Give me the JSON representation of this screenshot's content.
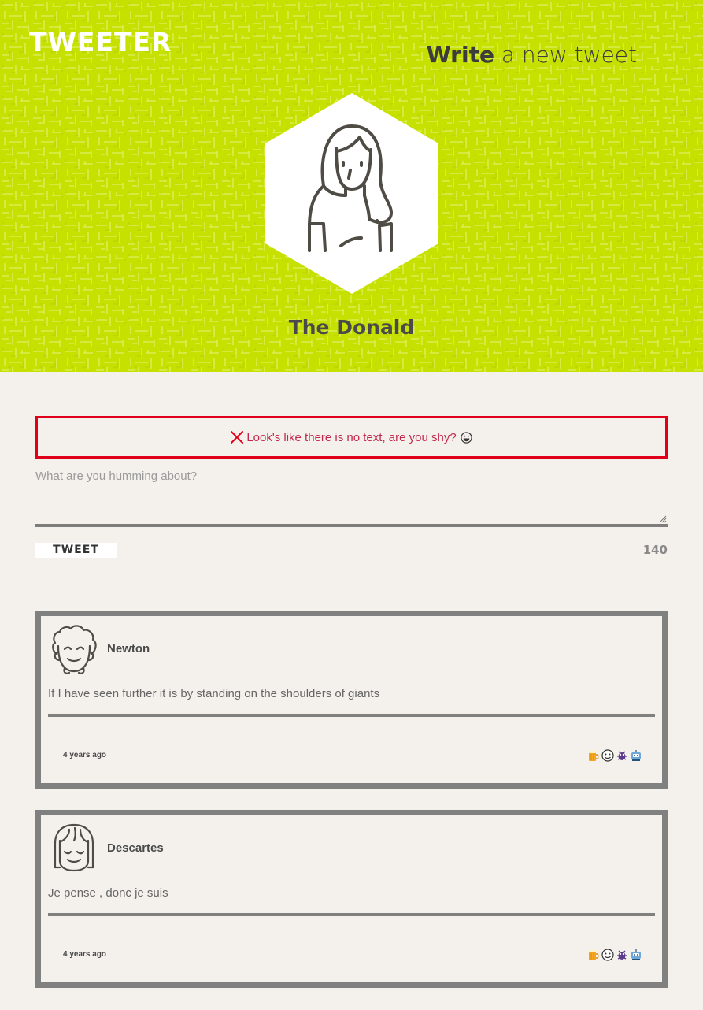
{
  "header": {
    "logo": "TWEETER",
    "title_bold": "Write",
    "title_rest": " a new tweet",
    "profile_name": "The Donald",
    "accent_color": "#c6e100"
  },
  "composer": {
    "error_message": "Look's like there is no text, are you shy?",
    "error_color": "#e0001b",
    "placeholder": "What are you humming about?",
    "value": "",
    "button_label": "TWEET",
    "char_count": "140"
  },
  "tweets": [
    {
      "author": "Newton",
      "text": "If I have seen further it is by standing on the shoulders of giants",
      "time": "4 years ago",
      "actions": [
        "beer-icon",
        "smiley-icon",
        "bug-icon",
        "robot-icon"
      ]
    },
    {
      "author": "Descartes",
      "text": "Je pense , donc je suis",
      "time": "4 years ago",
      "actions": [
        "beer-icon",
        "smiley-icon",
        "bug-icon",
        "robot-icon"
      ]
    }
  ]
}
